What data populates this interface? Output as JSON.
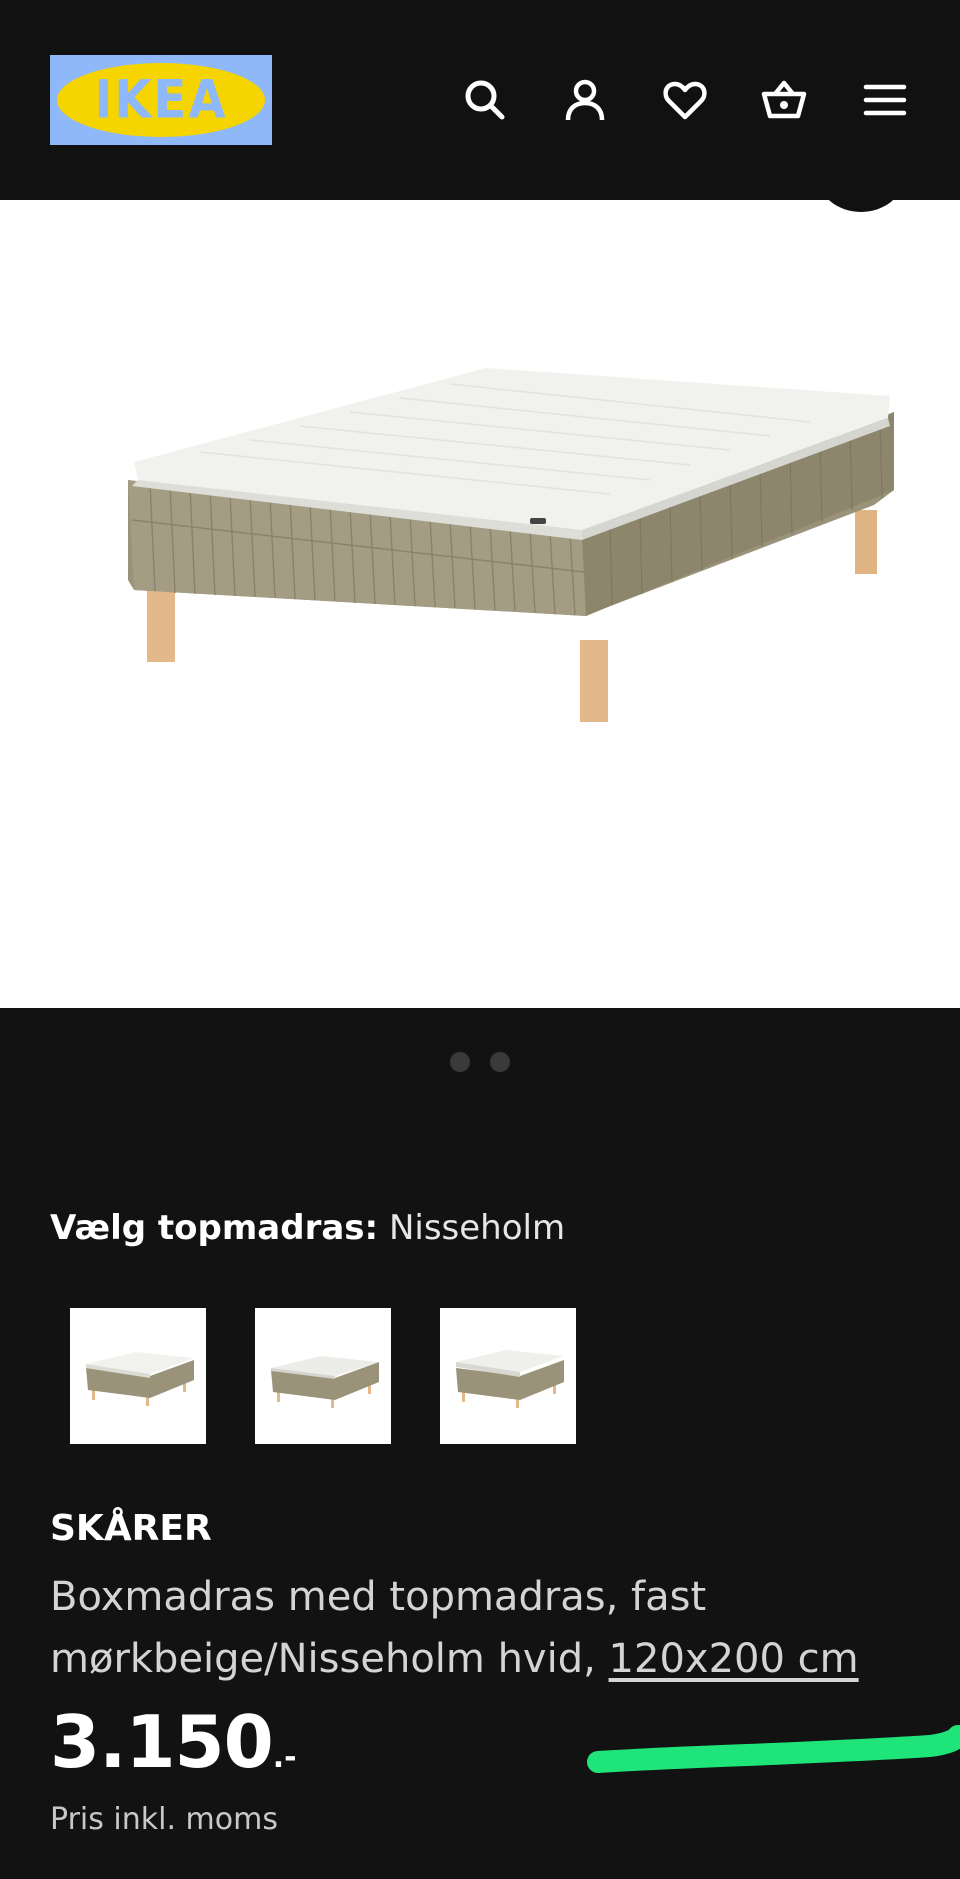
{
  "header": {
    "logo_text": "IKEA",
    "icons": [
      "search-icon",
      "account-icon",
      "heart-icon",
      "basket-icon",
      "menu-icon"
    ]
  },
  "gallery": {
    "image": "bed-image",
    "current_slide": 1,
    "total_slides": 2
  },
  "options": {
    "label": "Vælg topmadras:",
    "value": "Nisseholm",
    "thumbnails": [
      "topmadras-thumbnail-1",
      "topmadras-thumbnail-2",
      "topmadras-thumbnail-3"
    ]
  },
  "product": {
    "name": "SKÅRER",
    "description": "Boxmadras med topmadras, fast mørkbeige/Nisseholm hvid,",
    "size": "120x200 cm",
    "price": "3.150",
    "price_suffix": ".-",
    "vat_note": "Pris inkl. moms"
  },
  "colors": {
    "background": "#121212",
    "logo_blue": "#8fb8f8",
    "logo_yellow": "#f5d400",
    "scribble": "#1ee47a"
  }
}
